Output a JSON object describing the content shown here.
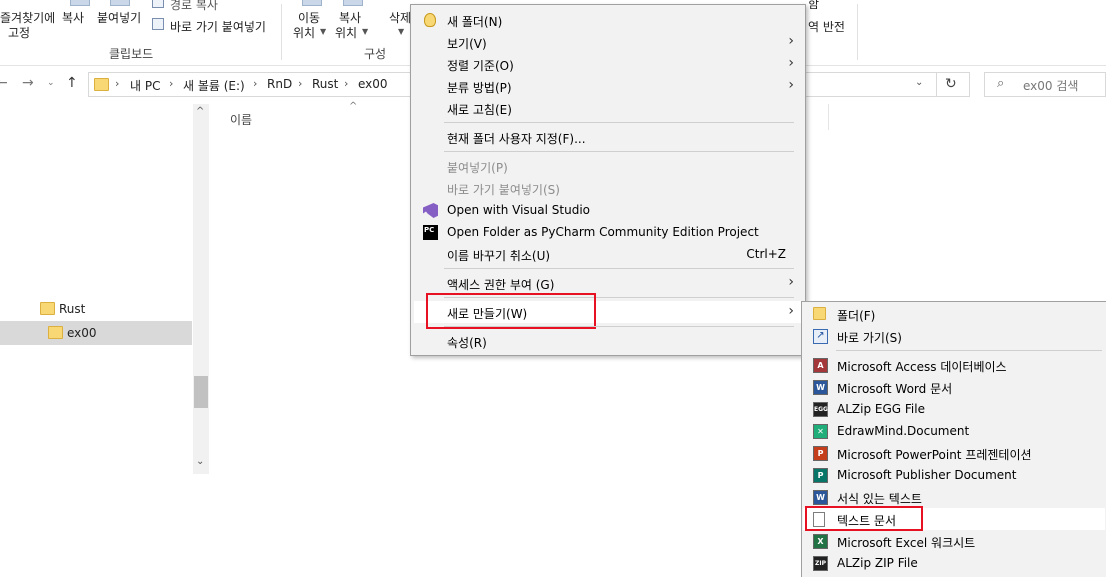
{
  "ribbon": {
    "pin_label_1": "즐겨찾기에",
    "pin_label_2": "고정",
    "copy_label": "복사",
    "paste_label": "붙여넣기",
    "copy_path_label": "경로 복사",
    "paste_shortcut_label": "바로 가기 붙여넣기",
    "clipboard_group": "클립보드",
    "move_label_1": "이동",
    "move_label_2": "위치",
    "copyto_label_1": "복사",
    "copyto_label_2": "위치",
    "delete_label": "삭제",
    "organize_group": "구성",
    "invert_label": "역 반전",
    "select_partial": "함"
  },
  "address": {
    "crumbs": [
      "내 PC",
      "새 볼륨 (E:)",
      "RnD",
      "Rust",
      "ex00"
    ],
    "search_placeholder": "ex00 검색"
  },
  "nav_pane": {
    "items": [
      {
        "label": "Rust",
        "selected": false
      },
      {
        "label": "ex00",
        "selected": true
      }
    ]
  },
  "content": {
    "column_name": "이름"
  },
  "context_menu": {
    "items": [
      {
        "label": "새 폴더(N)",
        "icon": "new-folder-icon"
      },
      {
        "label": "보기(V)",
        "has_submenu": true
      },
      {
        "label": "정렬 기준(O)",
        "has_submenu": true
      },
      {
        "label": "분류 방법(P)",
        "has_submenu": true
      },
      {
        "label": "새로 고침(E)"
      },
      {
        "label": "현재 폴더 사용자 지정(F)..."
      },
      {
        "label": "붙여넣기(P)",
        "disabled": true
      },
      {
        "label": "바로 가기 붙여넣기(S)",
        "disabled": true
      },
      {
        "label": "Open with Visual Studio",
        "icon": "visual-studio-icon"
      },
      {
        "label": "Open Folder as PyCharm Community Edition Project",
        "icon": "pycharm-icon"
      },
      {
        "label": "이름 바꾸기 취소(U)",
        "shortcut": "Ctrl+Z"
      },
      {
        "label": "액세스 권한 부여 (G)",
        "has_submenu": true
      },
      {
        "label": "새로 만들기(W)",
        "has_submenu": true,
        "highlighted": true
      },
      {
        "label": "속성(R)"
      }
    ]
  },
  "new_submenu": {
    "items": [
      {
        "label": "폴더(F)",
        "icon": "folder-icon"
      },
      {
        "label": "바로 가기(S)",
        "icon": "shortcut-icon"
      },
      {
        "label": "Microsoft Access 데이터베이스",
        "icon": "access-icon",
        "color": "#a4373a"
      },
      {
        "label": "Microsoft Word 문서",
        "icon": "word-icon",
        "color": "#2b579a"
      },
      {
        "label": "ALZip EGG File",
        "icon": "egg-file-icon",
        "color": "#222222"
      },
      {
        "label": "EdrawMind.Document",
        "icon": "edrawmind-icon",
        "color": "#1fae7a"
      },
      {
        "label": "Microsoft PowerPoint 프레젠테이션",
        "icon": "powerpoint-icon",
        "color": "#c43e1c"
      },
      {
        "label": "Microsoft Publisher Document",
        "icon": "publisher-icon",
        "color": "#077568"
      },
      {
        "label": "서식 있는 텍스트",
        "icon": "rtf-icon",
        "color": "#2b579a"
      },
      {
        "label": "텍스트 문서",
        "icon": "text-document-icon",
        "highlighted": true
      },
      {
        "label": "Microsoft Excel 워크시트",
        "icon": "excel-icon",
        "color": "#217346"
      },
      {
        "label": "ALZip ZIP File",
        "icon": "zip-file-icon",
        "color": "#222222"
      }
    ]
  },
  "colors": {
    "highlight_box": "#e81123",
    "menu_bg": "#f2f2f2",
    "selected_tree_bg": "#d9d9d9"
  }
}
